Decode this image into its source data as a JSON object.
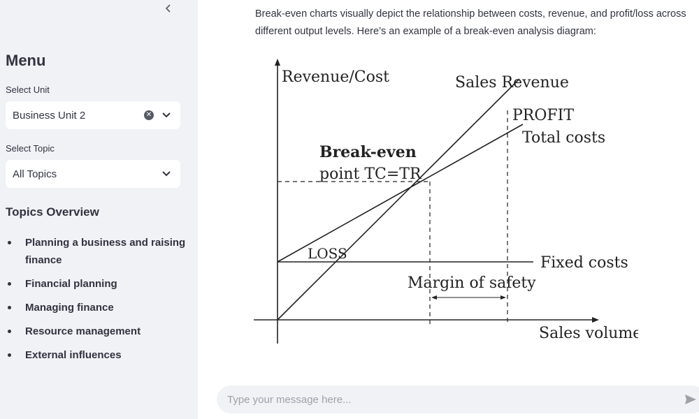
{
  "sidebar": {
    "menu_title": "Menu",
    "unit_label": "Select Unit",
    "unit_value": "Business Unit 2",
    "topic_label": "Select Topic",
    "topic_value": "All Topics",
    "topics_title": "Topics Overview",
    "topics": [
      "Planning a business and raising finance",
      "Financial planning",
      "Managing finance",
      "Resource management",
      "External influences"
    ]
  },
  "main": {
    "intro_line1": "Break-even charts visually depict the relationship between costs, revenue, and profit/loss across",
    "intro_line2": "different output levels. Here’s an example of a break-even analysis diagram:"
  },
  "diagram": {
    "y_axis_label": "Revenue/Cost",
    "x_axis_label": "Sales volume",
    "sales_revenue": "Sales Revenue",
    "profit": "PROFIT",
    "total_costs": "Total costs",
    "break_even_1": "Break-even",
    "break_even_2": "point TC=TR",
    "loss": "LOSS",
    "fixed_costs": "Fixed costs",
    "margin_of_safety": "Margin of safety"
  },
  "chat": {
    "placeholder": "Type your message here..."
  },
  "icons": {
    "collapse": "chevron-left-icon",
    "clear": "clear-icon",
    "dropdown": "chevron-down-icon",
    "send": "send-icon"
  }
}
